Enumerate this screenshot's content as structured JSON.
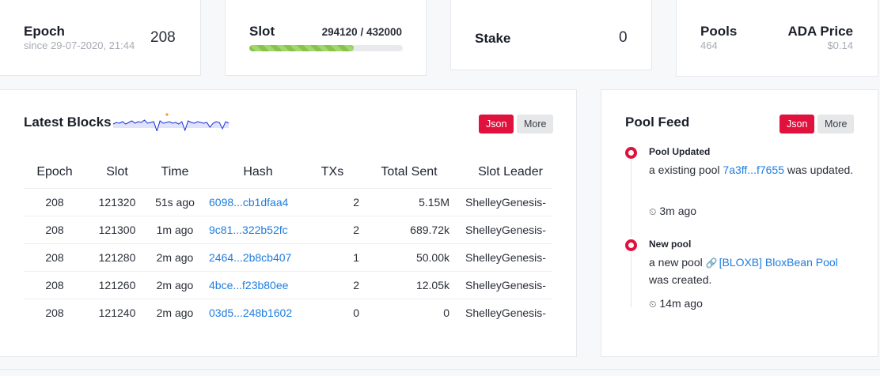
{
  "stats": {
    "epoch": {
      "title": "Epoch",
      "since": "since 29-07-2020, 21:44",
      "value": "208"
    },
    "slot": {
      "title": "Slot",
      "range": "294120 / 432000",
      "progress": 0.68
    },
    "stake": {
      "title": "Stake",
      "value": "0"
    },
    "pools": {
      "title": "Pools",
      "value": "464"
    },
    "price": {
      "title": "ADA Price",
      "value": "$0.14"
    }
  },
  "blocks_panel": {
    "title": "Latest Blocks",
    "json_label": "Json",
    "more_label": "More",
    "columns": [
      "Epoch",
      "Slot",
      "Time",
      "Hash",
      "TXs",
      "Total Sent",
      "Slot Leader"
    ],
    "rows": [
      {
        "epoch": "208",
        "slot": "121320",
        "time": "51s ago",
        "hash": "6098...cb1dfaa4",
        "txs": "2",
        "sent": "5.15M",
        "leader": "ShelleyGenesis-"
      },
      {
        "epoch": "208",
        "slot": "121300",
        "time": "1m ago",
        "hash": "9c81...322b52fc",
        "txs": "2",
        "sent": "689.72k",
        "leader": "ShelleyGenesis-"
      },
      {
        "epoch": "208",
        "slot": "121280",
        "time": "2m ago",
        "hash": "2464...2b8cb407",
        "txs": "1",
        "sent": "50.00k",
        "leader": "ShelleyGenesis-"
      },
      {
        "epoch": "208",
        "slot": "121260",
        "time": "2m ago",
        "hash": "4bce...f23b80ee",
        "txs": "2",
        "sent": "12.05k",
        "leader": "ShelleyGenesis-"
      },
      {
        "epoch": "208",
        "slot": "121240",
        "time": "2m ago",
        "hash": "03d5...248b1602",
        "txs": "0",
        "sent": "0",
        "leader": "ShelleyGenesis-"
      }
    ],
    "sparkline_colors": {
      "line": "#1a2fd6",
      "fill": "#dfe3fb",
      "spike": "#f29a1a"
    }
  },
  "pool_feed": {
    "title": "Pool Feed",
    "json_label": "Json",
    "more_label": "More",
    "items": [
      {
        "head": "Pool Updated",
        "pre": "a existing pool ",
        "link": "7a3ff...f7655",
        "post": " was updated.",
        "time": "3m ago"
      },
      {
        "head": "New pool",
        "pre": "a new pool ",
        "link": "[BLOXB] BloxBean Pool",
        "post": " was created.",
        "time": "14m ago"
      }
    ]
  },
  "colors": {
    "accent": "#e0113c",
    "link": "#1f7de0",
    "progress": "#86c54a"
  },
  "icons": {
    "time": "clock-icon",
    "pool_link": "link-icon"
  }
}
